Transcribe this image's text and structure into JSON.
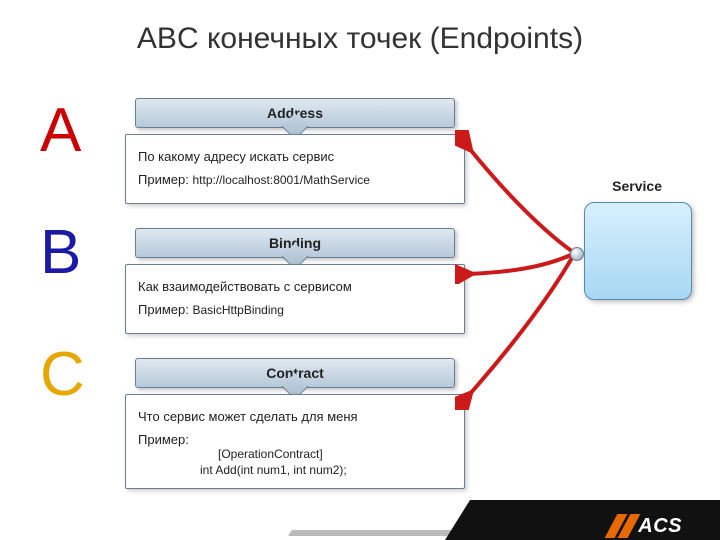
{
  "title": "ABC конечных точек (Endpoints)",
  "letters": {
    "a": "A",
    "b": "B",
    "c": "C"
  },
  "service": {
    "label": "Service"
  },
  "logo": {
    "text": "ACS"
  },
  "address": {
    "header": "Address",
    "desc": "По какому адресу искать сервис",
    "example_label": "Пример:",
    "example_value": "http://localhost:8001/MathService"
  },
  "binding": {
    "header": "Binding",
    "desc": "Как взаимодействовать с сервисом",
    "example_label": "Пример:",
    "example_value": "BasicHttpBinding"
  },
  "contract": {
    "header": "Contract",
    "desc": "Что сервис может сделать для меня",
    "example_label": "Пример:",
    "example_line1": "[OperationContract]",
    "example_line2": "int Add(int num1, int num2);"
  }
}
